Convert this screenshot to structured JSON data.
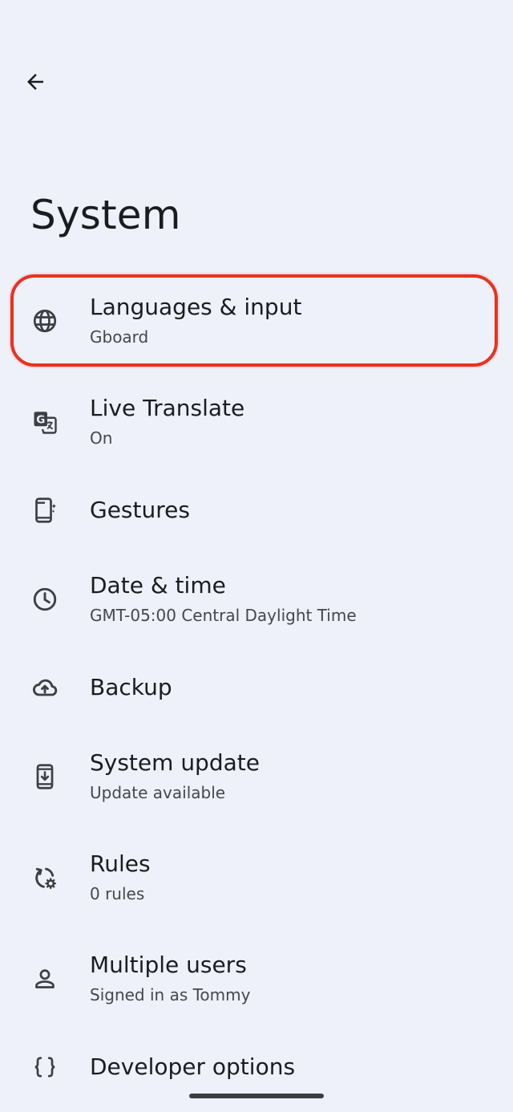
{
  "header": {
    "back_label": "Back",
    "title": "System"
  },
  "items": [
    {
      "label": "Languages & input",
      "sub": "Gboard",
      "icon": "globe-icon"
    },
    {
      "label": "Live Translate",
      "sub": "On",
      "icon": "translate-icon"
    },
    {
      "label": "Gestures",
      "sub": "",
      "icon": "gestures-phone-icon"
    },
    {
      "label": "Date & time",
      "sub": "GMT-05:00 Central Daylight Time",
      "icon": "clock-icon"
    },
    {
      "label": "Backup",
      "sub": "",
      "icon": "cloud-upload-icon"
    },
    {
      "label": "System update",
      "sub": "Update available",
      "icon": "system-update-icon"
    },
    {
      "label": "Rules",
      "sub": "0 rules",
      "icon": "rules-icon"
    },
    {
      "label": "Multiple users",
      "sub": "Signed in as Tommy",
      "icon": "person-icon"
    },
    {
      "label": "Developer options",
      "sub": "",
      "icon": "braces-icon"
    }
  ],
  "colors": {
    "background": "#eef1fa",
    "highlight": "#e8321f",
    "text_primary": "#1b1c20",
    "text_secondary": "#45474e"
  }
}
